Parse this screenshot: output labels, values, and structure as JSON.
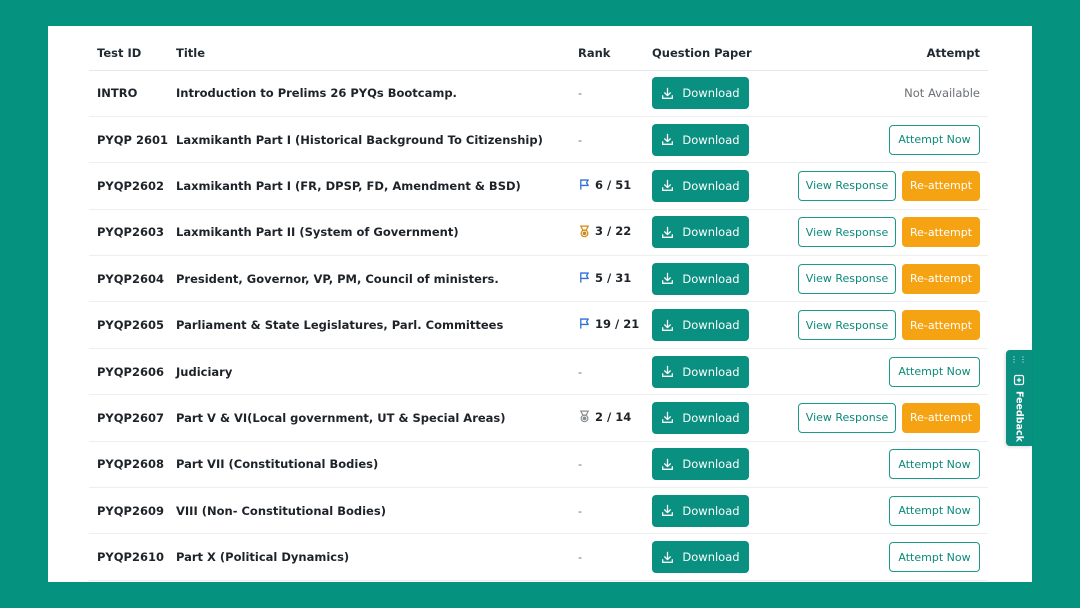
{
  "headers": {
    "test_id": "Test ID",
    "title": "Title",
    "rank": "Rank",
    "question_paper": "Question Paper",
    "attempt": "Attempt"
  },
  "download_label": "Download",
  "attempt_now_label": "Attempt Now",
  "view_response_label": "View Response",
  "reattempt_label": "Re-attempt",
  "not_available_label": "Not Available",
  "feedback_label": "Feedback",
  "rows": [
    {
      "id": "INTRO",
      "title": "Introduction to Prelims 26 PYQs Bootcamp.",
      "rank": "-",
      "rank_icon": "none",
      "attempt": "not_available"
    },
    {
      "id": "PYQP 2601",
      "title": "Laxmikanth Part I (Historical Background To Citizenship)",
      "rank": "-",
      "rank_icon": "none",
      "attempt": "attempt_now"
    },
    {
      "id": "PYQP2602",
      "title": "Laxmikanth Part I (FR, DPSP, FD, Amendment & BSD)",
      "rank": "6 / 51",
      "rank_icon": "flag-icon",
      "attempt": "view_reattempt"
    },
    {
      "id": "PYQP2603",
      "title": "Laxmikanth Part II (System of Government)",
      "rank": "3 / 22",
      "rank_icon": "bronze-medal-icon",
      "attempt": "view_reattempt"
    },
    {
      "id": "PYQP2604",
      "title": "President, Governor, VP, PM, Council of ministers.",
      "rank": "5 / 31",
      "rank_icon": "flag-icon",
      "attempt": "view_reattempt"
    },
    {
      "id": "PYQP2605",
      "title": "Parliament & State Legislatures, Parl. Committees",
      "rank": "19 / 21",
      "rank_icon": "flag-icon",
      "attempt": "view_reattempt"
    },
    {
      "id": "PYQP2606",
      "title": "Judiciary",
      "rank": "-",
      "rank_icon": "none",
      "attempt": "attempt_now"
    },
    {
      "id": "PYQP2607",
      "title": "Part V & VI(Local government, UT & Special Areas)",
      "rank": "2 / 14",
      "rank_icon": "silver-medal-icon",
      "attempt": "view_reattempt"
    },
    {
      "id": "PYQP2608",
      "title": "Part VII (Constitutional Bodies)",
      "rank": "-",
      "rank_icon": "none",
      "attempt": "attempt_now"
    },
    {
      "id": "PYQP2609",
      "title": "VIII (Non- Constitutional Bodies)",
      "rank": "-",
      "rank_icon": "none",
      "attempt": "attempt_now"
    },
    {
      "id": "PYQP2610",
      "title": "Part X (Political Dynamics)",
      "rank": "-",
      "rank_icon": "none",
      "attempt": "attempt_now"
    }
  ],
  "colors": {
    "background": "#05937f",
    "primary": "#0a9080",
    "reattempt": "#f5a312",
    "flag": "#2f6fd6",
    "bronze": "#d08a14",
    "silver": "#8a8f94"
  }
}
